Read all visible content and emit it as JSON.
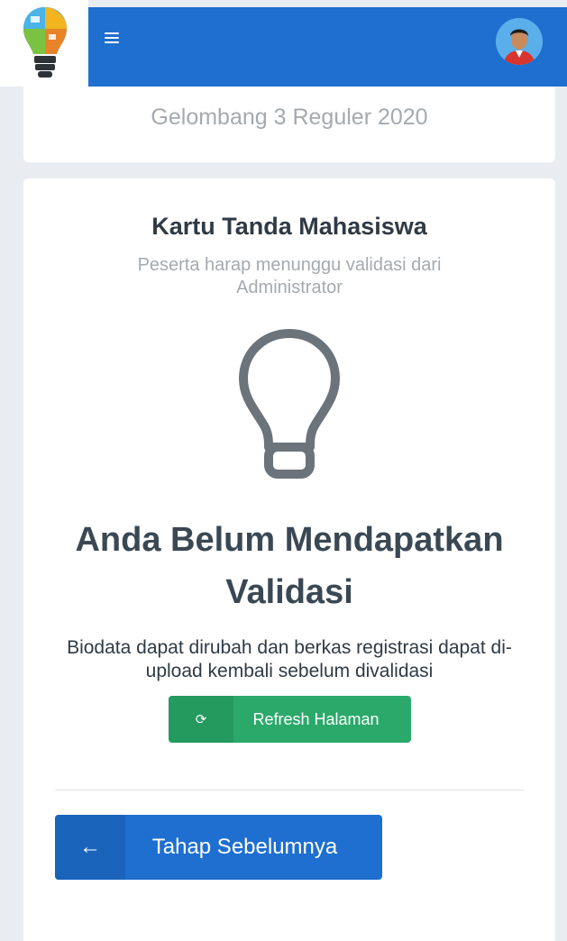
{
  "header": {
    "logo_icon": "lightbulb-puzzle-logo",
    "menu_icon": "hamburger-menu-icon",
    "avatar_icon": "user-avatar",
    "bar_color": "#1e6fd0"
  },
  "wave_card": {
    "text": "Gelombang 3 Reguler 2020"
  },
  "ktm": {
    "title": "Kartu Tanda Mahasiswa",
    "subtitle": "Peserta harap menunggu validasi dari Administrator",
    "illustration_icon": "lightbulb-icon",
    "headline": "Anda Belum Mendapatkan Validasi",
    "description": "Biodata dapat dirubah dan berkas registrasi dapat di-upload kembali sebelum divalidasi",
    "refresh_button": {
      "icon": "refresh-icon",
      "label": "Refresh Halaman",
      "color": "#2ba96a"
    },
    "prev_button": {
      "icon": "arrow-left-icon",
      "label": "Tahap Sebelumnya",
      "color": "#1e6fd0"
    }
  }
}
